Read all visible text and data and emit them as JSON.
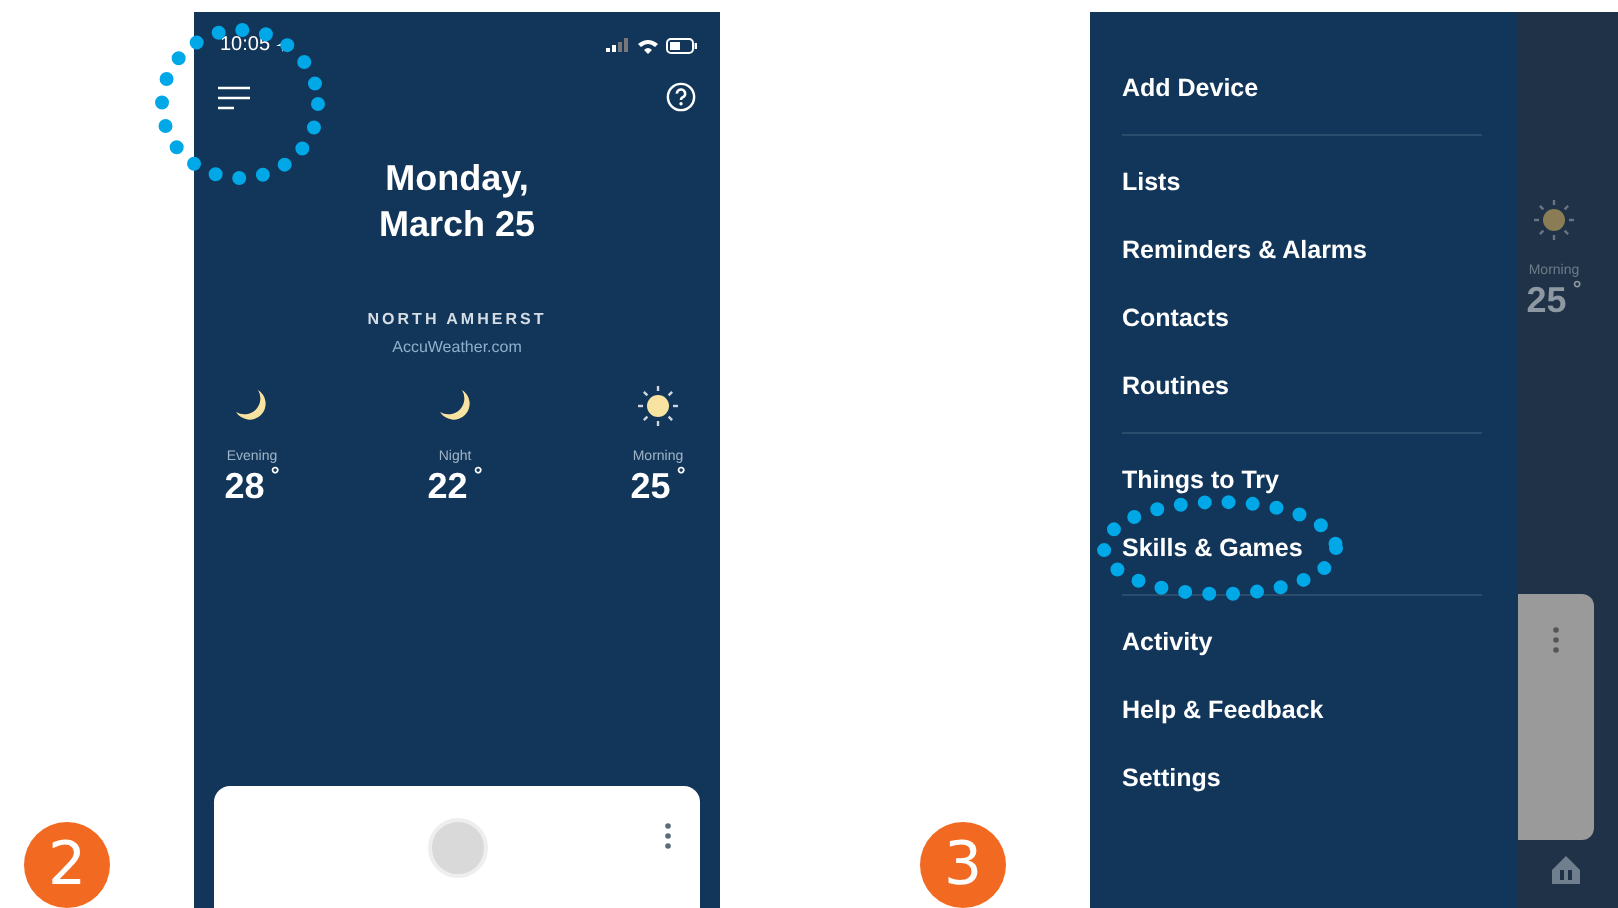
{
  "step_badges": [
    "2",
    "3"
  ],
  "home_screen": {
    "status_bar": {
      "time": "10:05"
    },
    "menu_button": {
      "highlighted": true
    },
    "date_lines": [
      "Monday,",
      "March 25"
    ],
    "location": "NORTH AMHERST",
    "source": "AccuWeather.com",
    "forecast": [
      {
        "kind": "moon",
        "period": "Evening",
        "temp": "28",
        "unit": "°"
      },
      {
        "kind": "moon",
        "period": "Night",
        "temp": "22",
        "unit": "°"
      },
      {
        "kind": "sun",
        "period": "Morning",
        "temp": "25",
        "unit": "°"
      }
    ]
  },
  "menu_screen": {
    "sections": [
      [
        {
          "label": "Add Device",
          "highlighted": false
        }
      ],
      [
        {
          "label": "Lists",
          "highlighted": false
        },
        {
          "label": "Reminders & Alarms",
          "highlighted": false
        },
        {
          "label": "Contacts",
          "highlighted": false
        },
        {
          "label": "Routines",
          "highlighted": false
        }
      ],
      [
        {
          "label": "Things to Try",
          "highlighted": false
        },
        {
          "label": "Skills & Games",
          "highlighted": true
        }
      ],
      [
        {
          "label": "Activity",
          "highlighted": false
        },
        {
          "label": "Help & Feedback",
          "highlighted": false
        },
        {
          "label": "Settings",
          "highlighted": false
        }
      ]
    ],
    "background_forecast": {
      "kind": "sun",
      "period": "Morning",
      "temp": "25",
      "unit": "°"
    }
  }
}
